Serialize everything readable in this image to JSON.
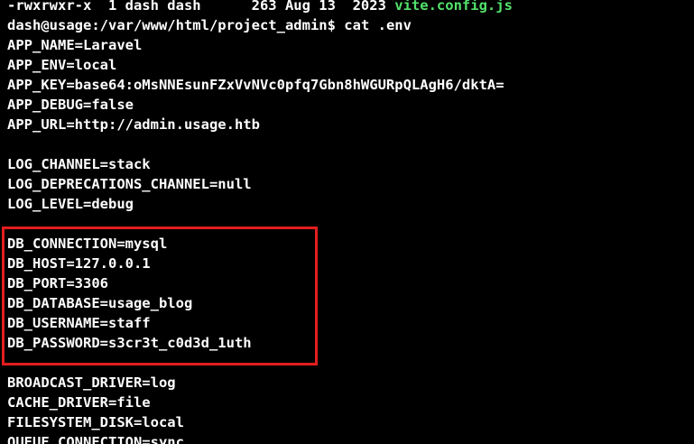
{
  "terminal": {
    "ls_line": {
      "prefix": "-rwxrwxr-x  1 dash dash      263 Aug 13  2023 ",
      "filename": "vite.config.js"
    },
    "prompt": "dash@usage:/var/www/html/project_admin$ ",
    "command": "cat .env",
    "env_app": [
      "APP_NAME=Laravel",
      "APP_ENV=local",
      "APP_KEY=base64:oMsNNEsunFZxVvNVc0pfq7Gbn8hWGURpQLAgH6/dktA=",
      "APP_DEBUG=false",
      "APP_URL=http://admin.usage.htb"
    ],
    "env_log": [
      "LOG_CHANNEL=stack",
      "LOG_DEPRECATIONS_CHANNEL=null",
      "LOG_LEVEL=debug"
    ],
    "env_db": [
      "DB_CONNECTION=mysql",
      "DB_HOST=127.0.0.1",
      "DB_PORT=3306",
      "DB_DATABASE=usage_blog",
      "DB_USERNAME=staff",
      "DB_PASSWORD=s3cr3t_c0d3d_1uth"
    ],
    "env_misc": [
      "BROADCAST_DRIVER=log",
      "CACHE_DRIVER=file",
      "FILESYSTEM_DISK=local",
      "QUEUE_CONNECTION=sync"
    ],
    "colors": {
      "background": "#000000",
      "text": "#ffffff",
      "executable": "#53e26b",
      "highlight": "#e21e1e"
    }
  }
}
